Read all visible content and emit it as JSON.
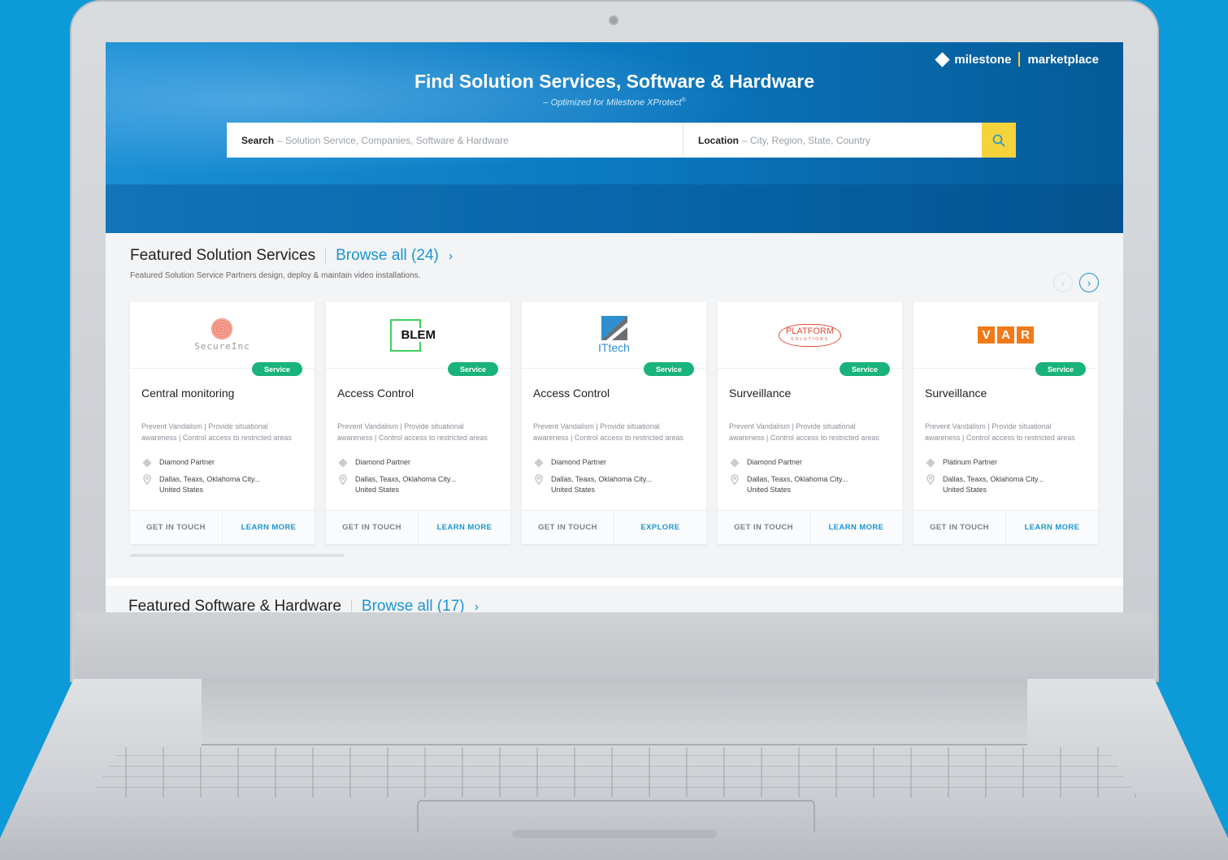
{
  "brand": {
    "name": "milestone",
    "product": "marketplace"
  },
  "hero": {
    "title": "Find Solution Services, Software & Hardware",
    "subtitle": "– Optimized for Milestone XProtect",
    "subtitle_mark": "®"
  },
  "search": {
    "search_label": "Search",
    "search_placeholder": "– Solution Service, Companies, Software & Hardware",
    "location_label": "Location",
    "location_placeholder": "– City, Region, State, Country"
  },
  "featured_services": {
    "title": "Featured Solution Services",
    "browse_label": "Browse all (24)",
    "browse_chevron": "›",
    "description": "Featured Solution Service Partners design, deploy & maintain video installations.",
    "prev": "‹",
    "next": "›",
    "cards": [
      {
        "logo": "SecureInc",
        "badge": "Service",
        "title": "Central monitoring",
        "description": "Prevent Vandalism | Provide situational awareness | Control access to restricted areas",
        "tier": "Diamond Partner",
        "location": "Dallas, Teaxs, Oklahoma City...",
        "country": "United States",
        "action_contact": "GET IN TOUCH",
        "action_primary": "LEARN MORE"
      },
      {
        "logo": "BLEM",
        "badge": "Service",
        "title": "Access Control",
        "description": "Prevent Vandalism | Provide situational awareness | Control access to restricted areas",
        "tier": "Diamond Partner",
        "location": "Dallas, Teaxs, Oklahoma City...",
        "country": "United States",
        "action_contact": "GET IN TOUCH",
        "action_primary": "LEARN MORE"
      },
      {
        "logo": "ITtech",
        "badge": "Service",
        "title": "Access Control",
        "description": "Prevent Vandalism | Provide situational awareness | Control access to restricted areas",
        "tier": "Diamond Partner",
        "location": "Dallas, Teaxs, Oklahoma City...",
        "country": "United States",
        "action_contact": "GET IN TOUCH",
        "action_primary": "EXPLORE"
      },
      {
        "logo": "PLATFORM",
        "logo_sub": "SOLUTIONS",
        "badge": "Service",
        "title": "Surveillance",
        "description": "Prevent Vandalism | Provide situational awareness | Control access to restricted areas",
        "tier": "Diamond Partner",
        "location": "Dallas, Teaxs, Oklahoma City...",
        "country": "United States",
        "action_contact": "GET IN TOUCH",
        "action_primary": "LEARN MORE"
      },
      {
        "logo": "VAR",
        "logo_letters": [
          "V",
          "A",
          "R"
        ],
        "badge": "Service",
        "title": "Surveillance",
        "description": "Prevent Vandalism | Provide situational awareness | Control access to restricted areas",
        "tier": "Platinum Partner",
        "location": "Dallas, Teaxs, Oklahoma City...",
        "country": "United States",
        "action_contact": "GET IN TOUCH",
        "action_primary": "LEARN MORE"
      }
    ]
  },
  "featured_products": {
    "title": "Featured Software & Hardware",
    "browse_label": "Browse all (17)",
    "browse_chevron": "›"
  },
  "colors": {
    "accent": "#1a95d2",
    "badge_green": "#19b37b",
    "search_button": "#f5d33b",
    "background": "#0c9ad9"
  },
  "icons": [
    "search-icon",
    "chevron-left-icon",
    "chevron-right-icon",
    "diamond-icon",
    "location-pin-icon"
  ]
}
